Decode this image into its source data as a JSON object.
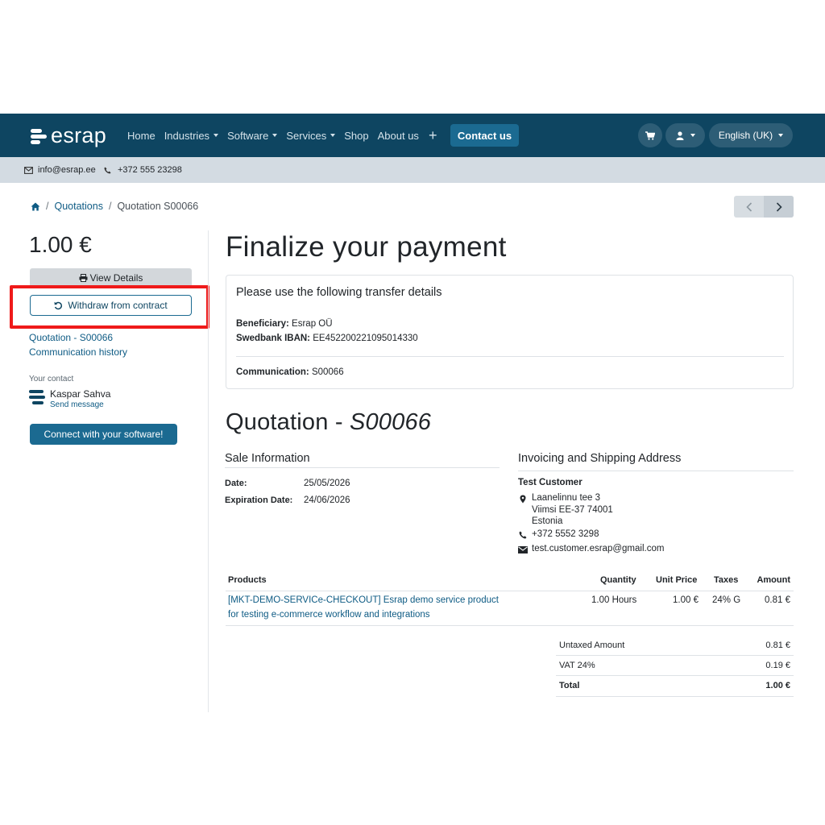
{
  "brand": {
    "name": "esrap"
  },
  "nav": {
    "items": [
      {
        "label": "Home",
        "dropdown": false
      },
      {
        "label": "Industries",
        "dropdown": true
      },
      {
        "label": "Software",
        "dropdown": true
      },
      {
        "label": "Services",
        "dropdown": true
      },
      {
        "label": "Shop",
        "dropdown": false
      },
      {
        "label": "About us",
        "dropdown": false
      }
    ],
    "plus": "+",
    "contact_label": "Contact us",
    "language": "English (UK)"
  },
  "topbar": {
    "email": "info@esrap.ee",
    "phone": "+372 555 23298"
  },
  "breadcrumb": {
    "first": "Quotations",
    "current": "Quotation S00066"
  },
  "sidebar": {
    "amount": "1.00 €",
    "view_details": "View Details",
    "withdraw": "Withdraw from contract",
    "link_quotation": "Quotation - S00066",
    "link_history": "Communication history",
    "your_contact": "Your contact",
    "contact_name": "Kaspar Sahva",
    "send_message": "Send message",
    "connect_label": "Connect with your software!"
  },
  "payment": {
    "title": "Finalize your payment",
    "card_title": "Please use the following transfer details",
    "beneficiary_label": "Beneficiary:",
    "beneficiary_value": "Esrap OÜ",
    "iban_label": "Swedbank IBAN:",
    "iban_value": "EE452200221095014330",
    "communication_label": "Communication:",
    "communication_value": "S00066"
  },
  "quotation": {
    "title_prefix": "Quotation - ",
    "title_ref": "S00066",
    "sale_info_title": "Sale Information",
    "date_label": "Date:",
    "date_value": "25/05/2026",
    "expiration_label": "Expiration Date:",
    "expiration_value": "24/06/2026",
    "address_title": "Invoicing and Shipping Address",
    "customer": "Test Customer",
    "street": "Laanelinnu tee 3",
    "city": "Viimsi EE-37 74001",
    "country": "Estonia",
    "phone": "+372 5552 3298",
    "email": "test.customer.esrap@gmail.com"
  },
  "products": {
    "headers": {
      "product": "Products",
      "quantity": "Quantity",
      "unit_price": "Unit Price",
      "taxes": "Taxes",
      "amount": "Amount"
    },
    "rows": [
      {
        "name_line1": "[MKT-DEMO-SERVICe-CHECKOUT] Esrap demo service product",
        "name_line2": "for testing e-commerce workflow and integrations",
        "quantity": "1.00 Hours",
        "unit_price": "1.00 €",
        "taxes": "24% G",
        "amount": "0.81 €"
      }
    ]
  },
  "totals": {
    "untaxed_label": "Untaxed Amount",
    "untaxed_value": "0.81 €",
    "vat_label": "VAT 24%",
    "vat_value": "0.19 €",
    "total_label": "Total",
    "total_value": "1.00 €"
  },
  "colors": {
    "navbar": "#0e4561",
    "accent": "#1b6a91",
    "link": "#0e5b84",
    "highlight": "#ef1a1a"
  }
}
